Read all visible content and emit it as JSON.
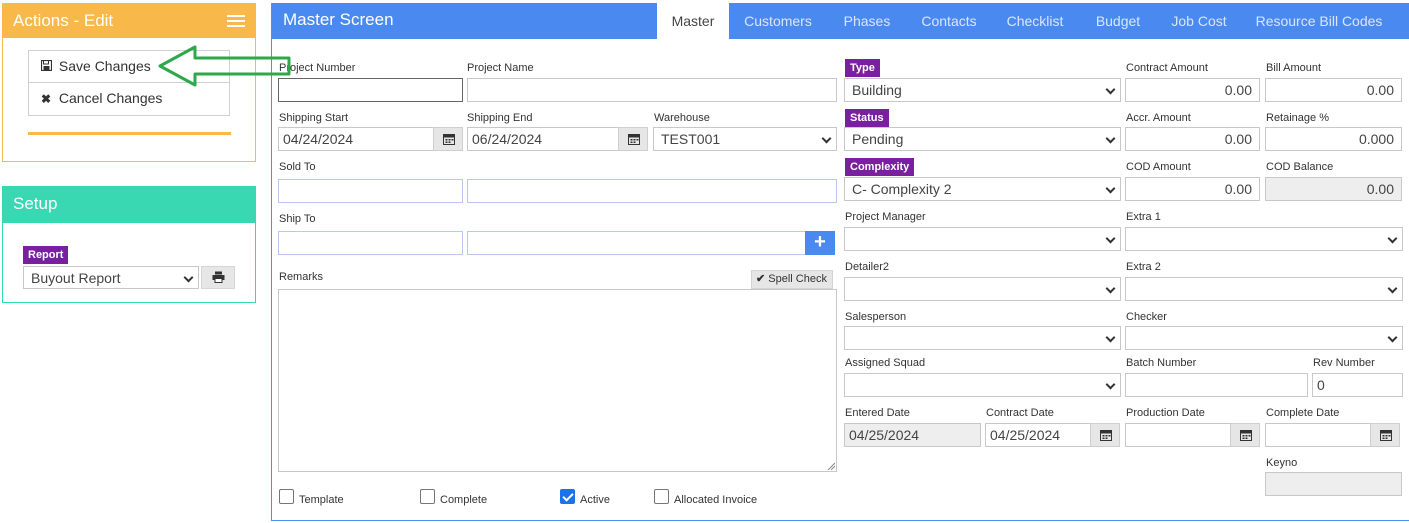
{
  "actions": {
    "title": "Actions - Edit",
    "save_label": "Save Changes",
    "cancel_label": "Cancel Changes"
  },
  "setup": {
    "title": "Setup",
    "report_label": "Report",
    "report_value": "Buyout Report"
  },
  "main": {
    "title": "Master Screen",
    "tabs": [
      {
        "label": "Master",
        "active": true
      },
      {
        "label": "Customers"
      },
      {
        "label": "Phases"
      },
      {
        "label": "Contacts"
      },
      {
        "label": "Checklist"
      },
      {
        "label": "Budget"
      },
      {
        "label": "Job Cost"
      },
      {
        "label": "Resource Bill Codes"
      }
    ]
  },
  "form": {
    "project_number": {
      "label": "Project Number",
      "value": ""
    },
    "project_name": {
      "label": "Project Name",
      "value": ""
    },
    "shipping_start": {
      "label": "Shipping Start",
      "value": "04/24/2024"
    },
    "shipping_end": {
      "label": "Shipping End",
      "value": "06/24/2024"
    },
    "warehouse": {
      "label": "Warehouse",
      "value": "TEST001"
    },
    "sold_to": {
      "label": "Sold To"
    },
    "ship_to": {
      "label": "Ship To"
    },
    "remarks": {
      "label": "Remarks"
    },
    "spell_check_label": "Spell Check",
    "type": {
      "label": "Type",
      "value": "Building"
    },
    "status": {
      "label": "Status",
      "value": "Pending"
    },
    "complexity": {
      "label": "Complexity",
      "value": "C- Complexity 2"
    },
    "project_manager": {
      "label": "Project Manager",
      "value": ""
    },
    "detailer2": {
      "label": "Detailer2",
      "value": ""
    },
    "salesperson": {
      "label": "Salesperson",
      "value": ""
    },
    "assigned_squad": {
      "label": "Assigned Squad",
      "value": ""
    },
    "contract_amount": {
      "label": "Contract Amount",
      "value": "0.00"
    },
    "bill_amount": {
      "label": "Bill Amount",
      "value": "0.00"
    },
    "accr_amount": {
      "label": "Accr. Amount",
      "value": "0.00"
    },
    "retainage": {
      "label": "Retainage %",
      "value": "0.000"
    },
    "cod_amount": {
      "label": "COD Amount",
      "value": "0.00"
    },
    "cod_balance": {
      "label": "COD Balance",
      "value": "0.00"
    },
    "extra1": {
      "label": "Extra 1",
      "value": ""
    },
    "extra2": {
      "label": "Extra 2",
      "value": ""
    },
    "checker": {
      "label": "Checker",
      "value": ""
    },
    "batch_number": {
      "label": "Batch Number",
      "value": ""
    },
    "rev_number": {
      "label": "Rev Number",
      "value": "0"
    },
    "entered_date": {
      "label": "Entered Date",
      "value": "04/25/2024"
    },
    "contract_date": {
      "label": "Contract Date",
      "value": "04/25/2024"
    },
    "production_date": {
      "label": "Production Date",
      "value": ""
    },
    "complete_date": {
      "label": "Complete Date",
      "value": ""
    },
    "keyno": {
      "label": "Keyno",
      "value": ""
    },
    "checkboxes": {
      "template": {
        "label": "Template",
        "checked": false
      },
      "complete": {
        "label": "Complete",
        "checked": false
      },
      "active": {
        "label": "Active",
        "checked": true
      },
      "allocated_invoice": {
        "label": "Allocated Invoice",
        "checked": false
      }
    }
  },
  "colors": {
    "actions_accent": "#f9b84a",
    "setup_accent": "#3ad7b3",
    "main_accent": "#4a8af0",
    "badge_purple": "#7a1fa2",
    "annotation_arrow": "#2ea84a"
  },
  "icons": [
    "menu-icon",
    "save-icon",
    "close-icon",
    "print-icon",
    "calendar-icon",
    "chevron-down-icon",
    "plus-icon",
    "check-icon"
  ]
}
